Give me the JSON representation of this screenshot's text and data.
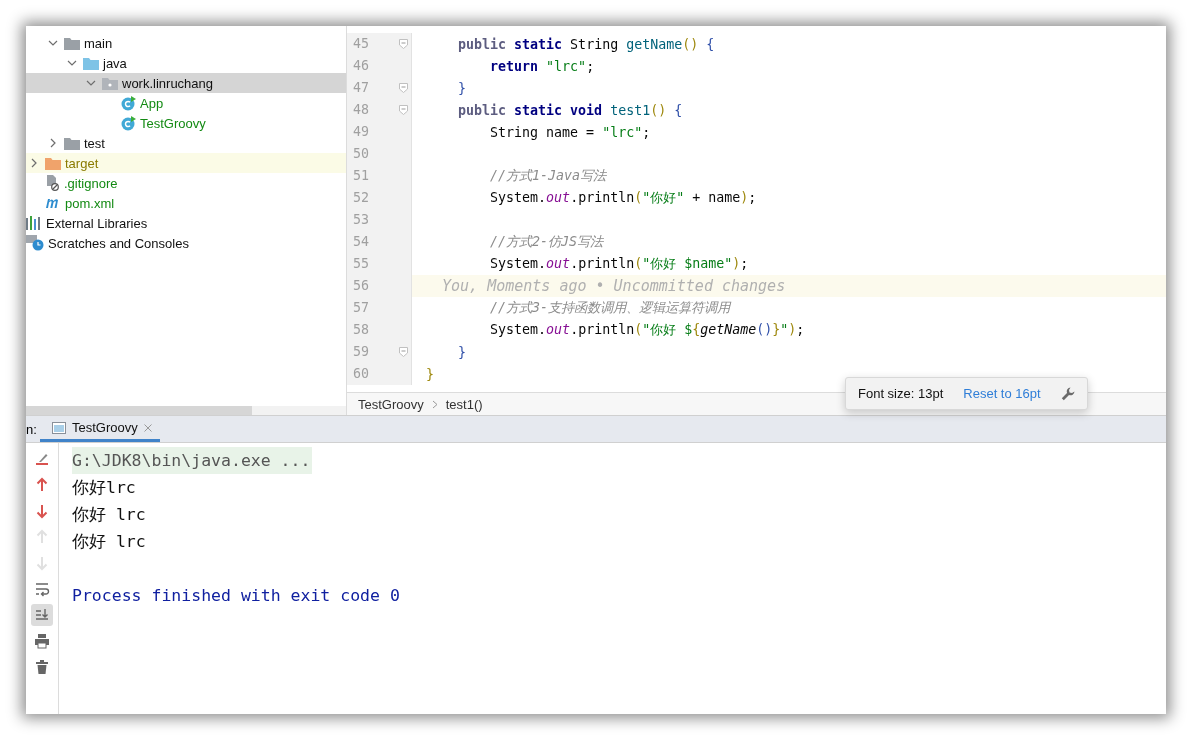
{
  "project_tree": {
    "src_children": [
      {
        "label": "main",
        "kind": "folder",
        "added": false,
        "ignored": false,
        "expanded": true,
        "selected": false,
        "children": [
          {
            "label": "java",
            "kind": "source-folder",
            "added": false,
            "ignored": false,
            "expanded": true,
            "selected": false,
            "children": [
              {
                "label": "work.linruchang",
                "kind": "package",
                "added": false,
                "ignored": false,
                "expanded": true,
                "selected": true,
                "children": [
                  {
                    "label": "App",
                    "kind": "class",
                    "added": true,
                    "ignored": false,
                    "selected": false
                  },
                  {
                    "label": "TestGroovy",
                    "kind": "class",
                    "added": true,
                    "ignored": false,
                    "selected": false
                  }
                ]
              }
            ]
          }
        ]
      },
      {
        "label": "test",
        "kind": "folder",
        "added": false,
        "ignored": false,
        "expanded": false,
        "selected": false
      }
    ],
    "items": [
      {
        "label": "target",
        "kind": "excluded-folder",
        "added": false,
        "ignored": true,
        "expanded": false,
        "selected": false
      },
      {
        "label": ".gitignore",
        "kind": "ignore-file",
        "added": true,
        "ignored": false,
        "selected": false
      },
      {
        "label": "pom.xml",
        "kind": "maven",
        "added": true,
        "ignored": false,
        "selected": false
      }
    ],
    "root_items": [
      {
        "label": "External Libraries",
        "kind": "libraries",
        "selected": false
      },
      {
        "label": "Scratches and Consoles",
        "kind": "scratches",
        "selected": false
      }
    ]
  },
  "editor": {
    "lines": [
      {
        "number": "45",
        "fold": true,
        "current": false,
        "tokens": [
          {
            "kind": "modifier",
            "text": "    public"
          },
          {
            "kind": "keyword",
            "text": " static"
          },
          {
            "kind": "plain",
            "text": " String "
          },
          {
            "kind": "method",
            "text": "getName"
          },
          {
            "kind": "paren",
            "text": "()"
          },
          {
            "kind": "brace",
            "text": " {"
          }
        ]
      },
      {
        "number": "46",
        "fold": false,
        "current": false,
        "tokens": [
          {
            "kind": "keyword",
            "text": "        return"
          },
          {
            "kind": "string",
            "text": " \"lrc\""
          },
          {
            "kind": "plain",
            "text": ";"
          }
        ]
      },
      {
        "number": "47",
        "fold": true,
        "current": false,
        "tokens": [
          {
            "kind": "brace",
            "text": "    }"
          }
        ]
      },
      {
        "number": "48",
        "fold": true,
        "current": false,
        "tokens": [
          {
            "kind": "modifier",
            "text": "    public"
          },
          {
            "kind": "keyword",
            "text": " static void"
          },
          {
            "kind": "method",
            "text": " test1"
          },
          {
            "kind": "paren",
            "text": "()"
          },
          {
            "kind": "brace",
            "text": " {"
          }
        ]
      },
      {
        "number": "49",
        "fold": false,
        "current": false,
        "tokens": [
          {
            "kind": "plain",
            "text": "        String name = "
          },
          {
            "kind": "string",
            "text": "\"lrc\""
          },
          {
            "kind": "plain",
            "text": ";"
          }
        ]
      },
      {
        "number": "50",
        "fold": false,
        "current": false
      },
      {
        "number": "51",
        "fold": false,
        "current": false,
        "tokens": [
          {
            "kind": "comment",
            "text": "        //方式1-Java写法"
          }
        ]
      },
      {
        "number": "52",
        "fold": false,
        "current": false,
        "tokens": [
          {
            "kind": "plain",
            "text": "        System."
          },
          {
            "kind": "field",
            "text": "out"
          },
          {
            "kind": "plain",
            "text": ".println"
          },
          {
            "kind": "paren",
            "text": "("
          },
          {
            "kind": "string",
            "text": "\"你好\""
          },
          {
            "kind": "plain",
            "text": " + name"
          },
          {
            "kind": "paren",
            "text": ")"
          },
          {
            "kind": "plain",
            "text": ";"
          }
        ]
      },
      {
        "number": "53",
        "fold": false,
        "current": false
      },
      {
        "number": "54",
        "fold": false,
        "current": false,
        "tokens": [
          {
            "kind": "comment",
            "text": "        //方式2-仿JS写法"
          }
        ]
      },
      {
        "number": "55",
        "fold": false,
        "current": false,
        "tokens": [
          {
            "kind": "plain",
            "text": "        System."
          },
          {
            "kind": "field",
            "text": "out"
          },
          {
            "kind": "plain",
            "text": ".println"
          },
          {
            "kind": "paren",
            "text": "("
          },
          {
            "kind": "string",
            "text": "\"你好 $name\""
          },
          {
            "kind": "paren",
            "text": ")"
          },
          {
            "kind": "plain",
            "text": ";"
          }
        ]
      },
      {
        "number": "56",
        "fold": false,
        "current": true,
        "annotation": "You, Moments ago • Uncommitted changes"
      },
      {
        "number": "57",
        "fold": false,
        "current": false,
        "tokens": [
          {
            "kind": "comment",
            "text": "        //方式3-支持函数调用、逻辑运算符调用"
          }
        ]
      },
      {
        "number": "58",
        "fold": false,
        "current": false,
        "tokens": [
          {
            "kind": "plain",
            "text": "        System."
          },
          {
            "kind": "field",
            "text": "out"
          },
          {
            "kind": "plain",
            "text": ".println"
          },
          {
            "kind": "paren",
            "text": "("
          },
          {
            "kind": "string",
            "text": "\"你好 $"
          },
          {
            "kind": "paren",
            "text": "{"
          },
          {
            "kind": "call",
            "text": "getName"
          },
          {
            "kind": "brace",
            "text": "()"
          },
          {
            "kind": "paren",
            "text": "}"
          },
          {
            "kind": "string",
            "text": "\""
          },
          {
            "kind": "paren",
            "text": ")"
          },
          {
            "kind": "plain",
            "text": ";"
          }
        ]
      },
      {
        "number": "59",
        "fold": true,
        "current": false,
        "tokens": [
          {
            "kind": "brace",
            "text": "    }"
          }
        ]
      },
      {
        "number": "60",
        "fold": false,
        "current": false,
        "tokens": [
          {
            "kind": "paren",
            "text": "}"
          }
        ]
      }
    ],
    "breadcrumbs": [
      "TestGroovy",
      "test1()"
    ]
  },
  "font_popup": {
    "message": "Font size: 13pt",
    "link": "Reset to 16pt"
  },
  "run_panel": {
    "label": "n:",
    "tabs": [
      {
        "label": "TestGroovy",
        "selected": true
      }
    ],
    "tools": [
      {
        "kind": "clear",
        "disabled": false,
        "on": false
      },
      {
        "kind": "up",
        "disabled": false,
        "on": false
      },
      {
        "kind": "down",
        "disabled": false,
        "on": false
      },
      {
        "kind": "up",
        "disabled": true,
        "on": false
      },
      {
        "kind": "down",
        "disabled": true,
        "on": false
      },
      {
        "kind": "wrap",
        "disabled": false,
        "on": false
      },
      {
        "kind": "scroll-end",
        "disabled": false,
        "on": true
      },
      {
        "kind": "print",
        "disabled": false,
        "on": false
      },
      {
        "kind": "delete",
        "disabled": false,
        "on": false
      }
    ],
    "output": [
      {
        "kind": "command",
        "text": "G:\\JDK8\\bin\\java.exe ..."
      },
      {
        "kind": "stdout",
        "text": "你好lrc"
      },
      {
        "kind": "stdout",
        "text": "你好 lrc"
      },
      {
        "kind": "stdout",
        "text": "你好 lrc"
      },
      {
        "kind": "system",
        "text": "Process finished with exit code 0"
      }
    ]
  }
}
